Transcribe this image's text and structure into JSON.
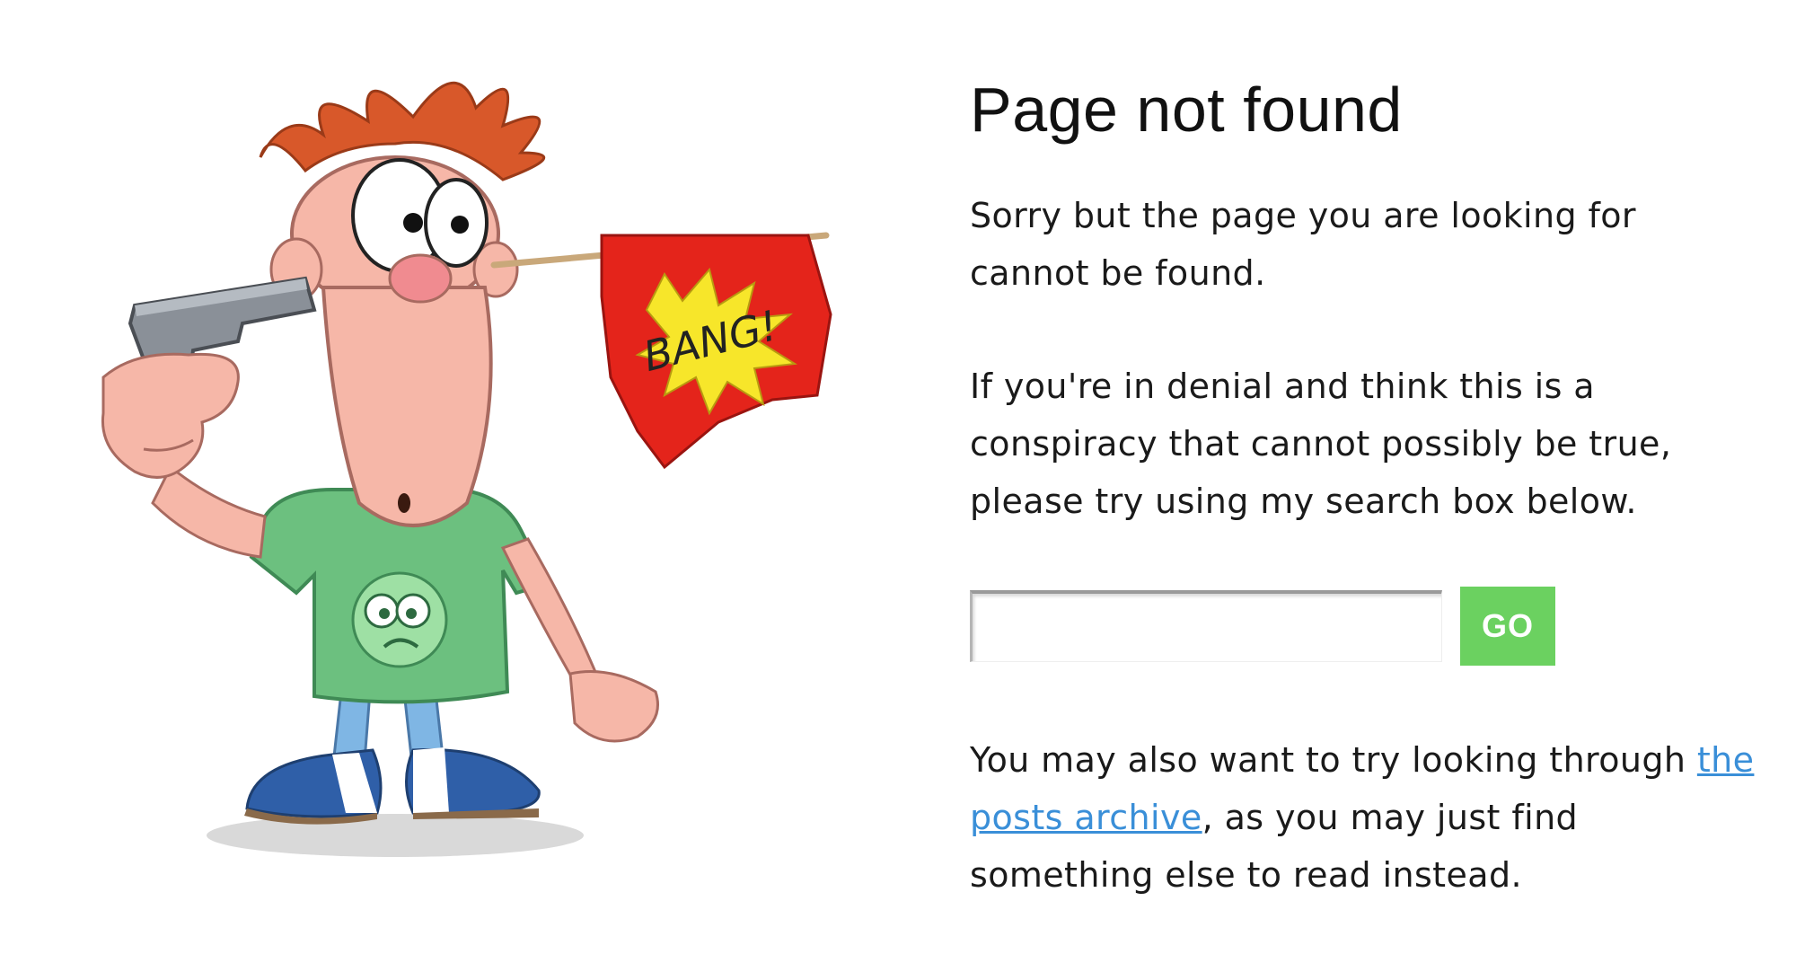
{
  "page": {
    "title": "Page not found",
    "intro": "Sorry but the page you are looking for cannot be found.",
    "denial": "If you're in denial and think this is a conspiracy that cannot possibly be true, please try using my search box below."
  },
  "search": {
    "value": "",
    "placeholder": "",
    "button_label": "GO"
  },
  "archive": {
    "text_before": "You may also want to try looking through ",
    "link_label": "the posts archive",
    "text_after": ", as you may just find something else to read instead."
  },
  "illustration": {
    "flag_text": "BANG!",
    "icon": "cartoon-man-with-gun-icon"
  },
  "colors": {
    "go_button": "#6bd160",
    "link": "#3a8fd8",
    "flag_red": "#e4241b",
    "flag_burst": "#f7e62a",
    "hair": "#d8582a",
    "shirt": "#6cc07f",
    "skin": "#f6b7a8",
    "shoes": "#2f5fa8"
  }
}
